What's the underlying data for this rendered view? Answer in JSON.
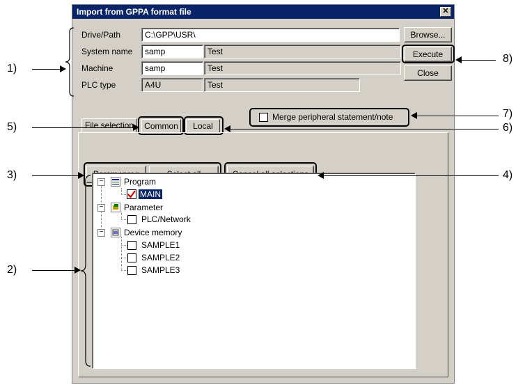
{
  "dialog": {
    "title": "Import from GPPA format file",
    "close_symbol": "✕",
    "fields": {
      "drive_path_label": "Drive/Path",
      "drive_path_value": "C:\\GPP\\USR\\",
      "system_name_label": "System name",
      "system_name_value": "samp",
      "system_name_comment": "Test",
      "machine_label": "Machine",
      "machine_value": "samp",
      "machine_comment": "Test",
      "plc_type_label": "PLC type",
      "plc_type_value": "A4U",
      "plc_type_comment": "Test"
    },
    "buttons": {
      "browse": "Browse...",
      "execute": "Execute",
      "close": "Close",
      "param_prog": "Param+prog",
      "select_all": "Select all",
      "cancel_all": "Cancel all selections"
    },
    "merge_checkbox_label": "Merge peripheral statement/note",
    "tabs": [
      "File selection",
      "Common",
      "Local"
    ],
    "tree": {
      "program": "Program",
      "program_children": [
        "MAIN"
      ],
      "parameter": "Parameter",
      "parameter_children": [
        "PLC/Network"
      ],
      "device_memory": "Device memory",
      "device_memory_children": [
        "SAMPLE1",
        "SAMPLE2",
        "SAMPLE3"
      ]
    }
  },
  "callouts": [
    "1)",
    "2)",
    "3)",
    "4)",
    "5)",
    "6)",
    "7)",
    "8)"
  ]
}
